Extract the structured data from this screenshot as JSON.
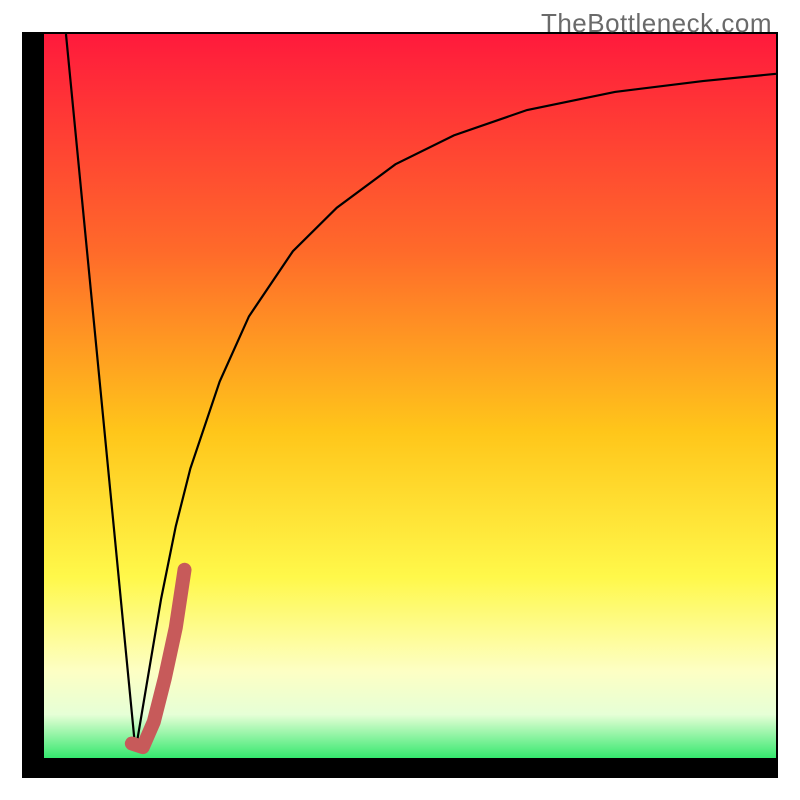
{
  "watermark": "TheBottleneck.com",
  "colors": {
    "gradient_top": "#ff1a3c",
    "gradient_upper_mid": "#ff6a2a",
    "gradient_mid": "#ffc61a",
    "gradient_lower_mid": "#fff84a",
    "gradient_pale": "#fdffc4",
    "gradient_near_bottom": "#e6ffd6",
    "gradient_bottom": "#35e86e",
    "frame": "#000000",
    "curve": "#000000",
    "accent_marker": "#c75a5a"
  },
  "chart_data": {
    "type": "line",
    "title": "",
    "xlabel": "",
    "ylabel": "",
    "xlim": [
      0,
      100
    ],
    "ylim": [
      0,
      100
    ],
    "grid": false,
    "legend": false,
    "annotations": [],
    "series": [
      {
        "name": "v-left-line",
        "x": [
          3,
          12.5
        ],
        "values": [
          100,
          1
        ]
      },
      {
        "name": "v-right-curve",
        "x": [
          12.5,
          14,
          16,
          18,
          20,
          24,
          28,
          34,
          40,
          48,
          56,
          66,
          78,
          90,
          100
        ],
        "values": [
          1,
          10,
          22,
          32,
          40,
          52,
          61,
          70,
          76,
          82,
          86,
          89.5,
          92,
          93.5,
          94.5
        ]
      },
      {
        "name": "accent-marker",
        "x": [
          12,
          13.5,
          15,
          16.5,
          18,
          19.2
        ],
        "values": [
          2,
          1.5,
          5,
          11,
          18,
          26
        ]
      }
    ]
  }
}
